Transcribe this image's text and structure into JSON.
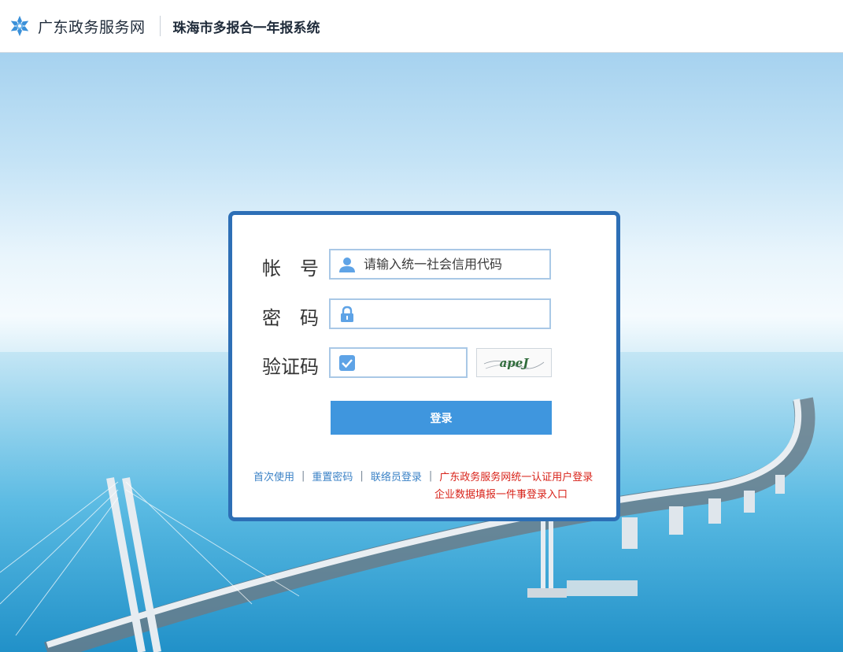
{
  "header": {
    "brand": "广东政务服务网",
    "system_title": "珠海市多报合一年报系统"
  },
  "login": {
    "account_label": "帐　号",
    "account_placeholder": "请输入统一社会信用代码",
    "password_label": "密　码",
    "captcha_label": "验证码",
    "captcha_text": "apeJ",
    "login_button": "登录"
  },
  "links": {
    "first_use": "首次使用",
    "separator": "|",
    "reset_password": "重置密码",
    "liaison_login": "联络员登录",
    "unified_login": "广东政务服务网统一认证用户登录",
    "enterprise_login": "企业数据填报一件事登录入口"
  },
  "colors": {
    "card_border": "#2d6fb6",
    "button": "#3f96de",
    "link_blue": "#3b82c6",
    "link_red": "#d8231a"
  }
}
